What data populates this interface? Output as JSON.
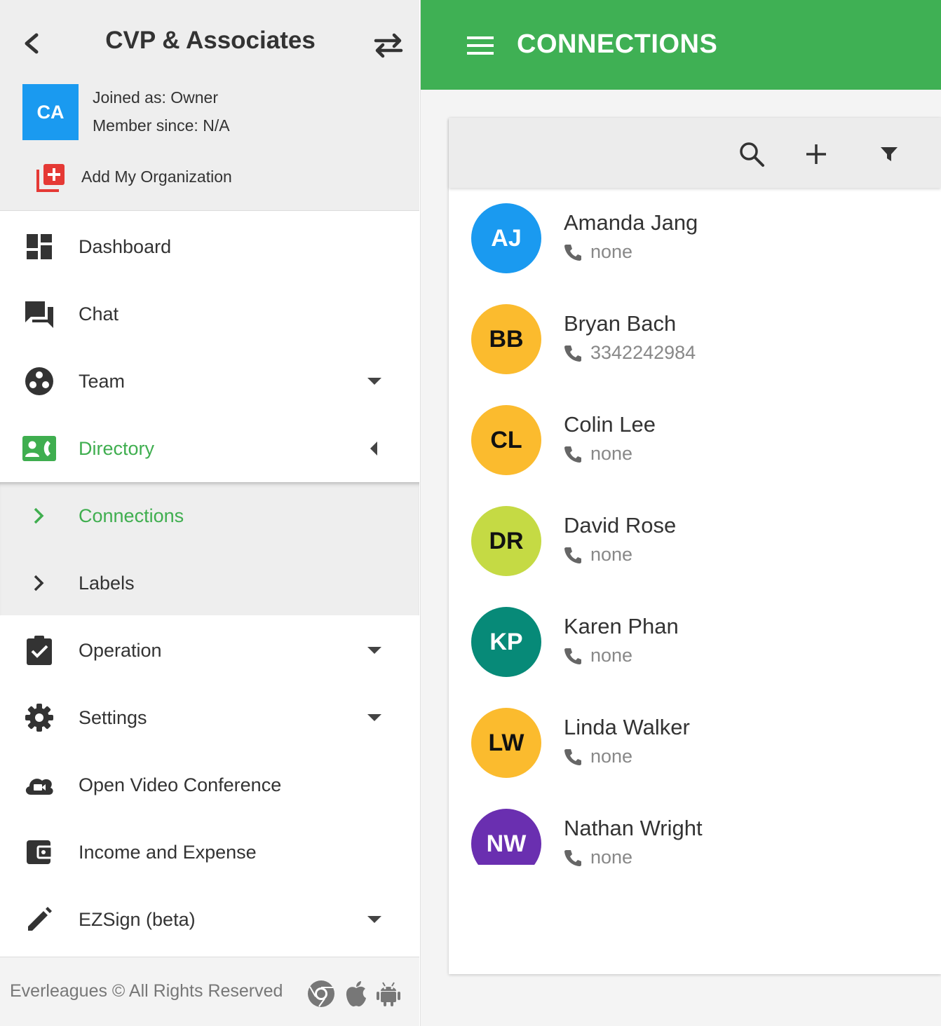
{
  "sidebar": {
    "org_name": "CVP & Associates",
    "org_initials": "CA",
    "joined_as": "Joined as: Owner",
    "member_since": "Member since: N/A",
    "add_org_label": "Add My Organization",
    "accent_color": "#3fae4f",
    "nav": {
      "dashboard": "Dashboard",
      "chat": "Chat",
      "team": "Team",
      "directory": "Directory",
      "operation": "Operation",
      "settings": "Settings",
      "video": "Open Video Conference",
      "income": "Income and Expense",
      "ezsign": "EZSign (beta)"
    },
    "submenu": {
      "connections": "Connections",
      "labels": "Labels"
    },
    "footer": {
      "copyright": "Everleagues © All Rights Reserved",
      "platforms": [
        "chrome-icon",
        "apple-icon",
        "android-icon"
      ]
    }
  },
  "header": {
    "title": "CONNECTIONS",
    "color": "#3fb054"
  },
  "contacts": [
    {
      "initials": "AJ",
      "name": "Amanda Jang",
      "phone": "none",
      "color": "#1a9af0",
      "text_color": "#ffffff"
    },
    {
      "initials": "BB",
      "name": "Bryan Bach",
      "phone": "3342242984",
      "color": "#fbbb2e",
      "text_color": "#111111"
    },
    {
      "initials": "CL",
      "name": "Colin Lee",
      "phone": "none",
      "color": "#fbbb2e",
      "text_color": "#111111"
    },
    {
      "initials": "DR",
      "name": "David Rose",
      "phone": "none",
      "color": "#c5da44",
      "text_color": "#111111"
    },
    {
      "initials": "KP",
      "name": "Karen Phan",
      "phone": "none",
      "color": "#078a78",
      "text_color": "#ffffff"
    },
    {
      "initials": "LW",
      "name": "Linda Walker",
      "phone": "none",
      "color": "#fbbb2e",
      "text_color": "#111111"
    },
    {
      "initials": "NW",
      "name": "Nathan Wright",
      "phone": "none",
      "color": "#6a2fb0",
      "text_color": "#ffffff"
    }
  ]
}
